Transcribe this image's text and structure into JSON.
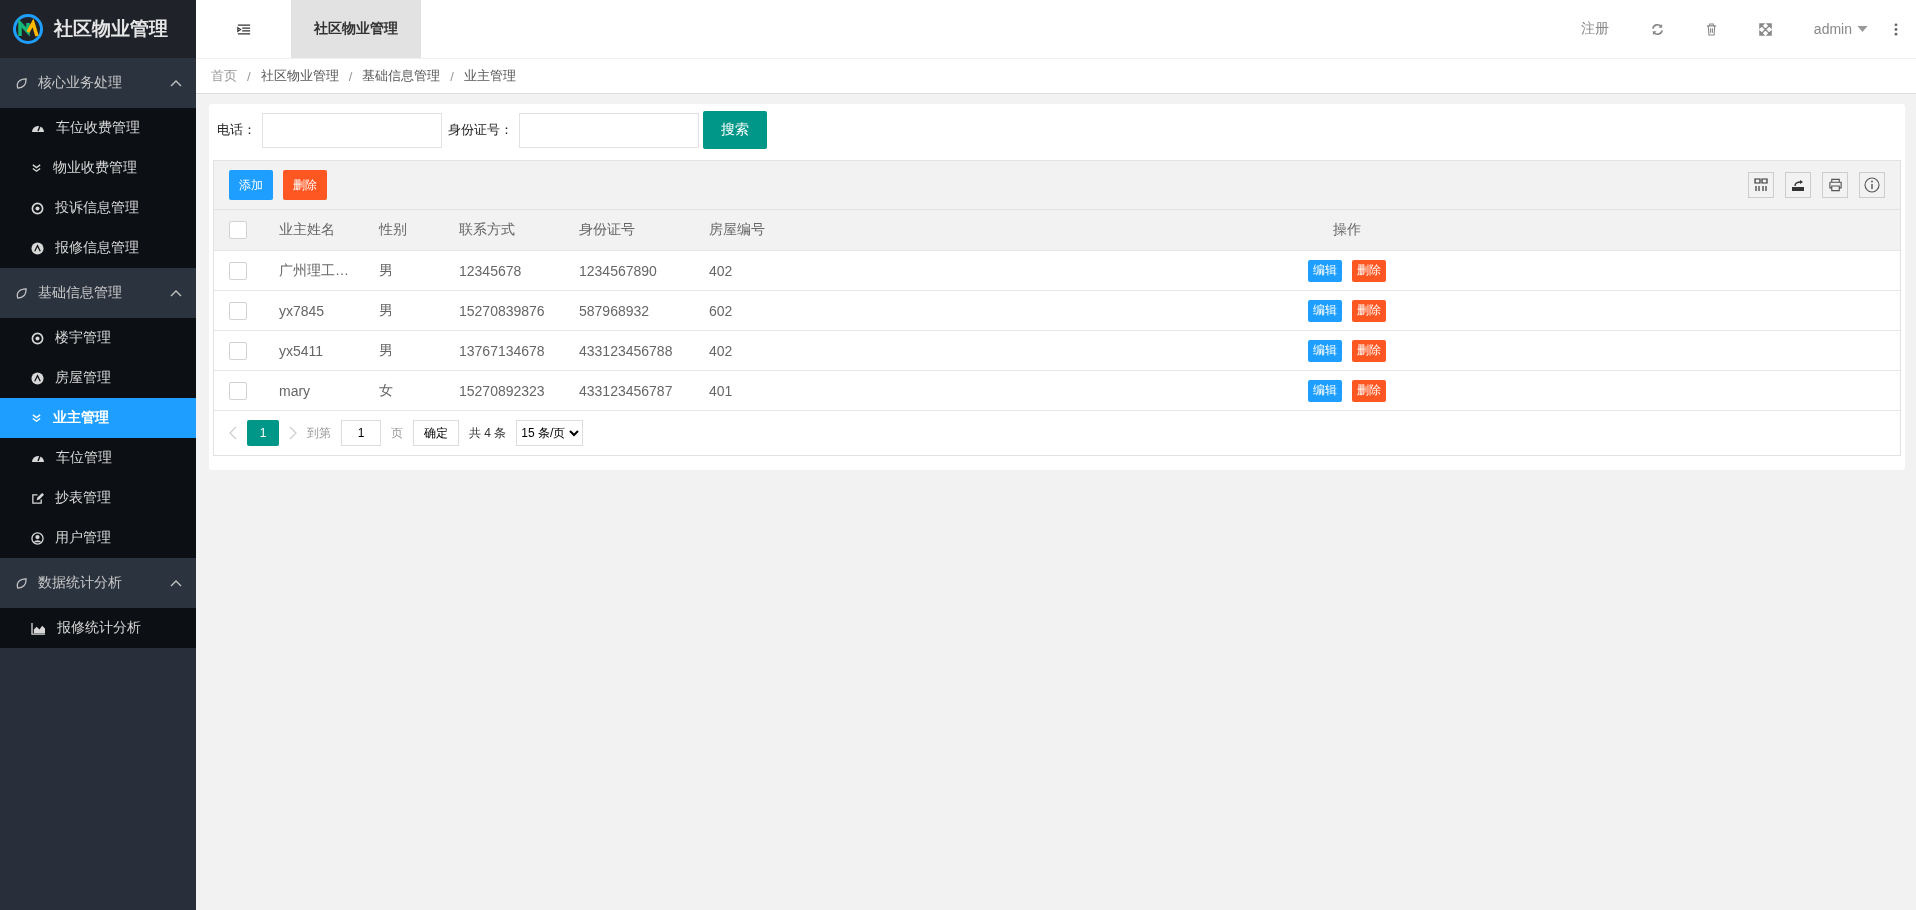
{
  "brand": {
    "title": "社区物业管理"
  },
  "sidebar": {
    "groups": [
      {
        "label": "核心业务处理",
        "expanded": true,
        "items": [
          {
            "label": "车位收费管理",
            "selected": false
          },
          {
            "label": "物业收费管理",
            "selected": false
          },
          {
            "label": "投诉信息管理",
            "selected": false
          },
          {
            "label": "报修信息管理",
            "selected": false
          }
        ]
      },
      {
        "label": "基础信息管理",
        "expanded": true,
        "items": [
          {
            "label": "楼宇管理",
            "selected": false
          },
          {
            "label": "房屋管理",
            "selected": false
          },
          {
            "label": "业主管理",
            "selected": true
          },
          {
            "label": "车位管理",
            "selected": false
          },
          {
            "label": "抄表管理",
            "selected": false
          },
          {
            "label": "用户管理",
            "selected": false
          }
        ]
      },
      {
        "label": "数据统计分析",
        "expanded": true,
        "items": [
          {
            "label": "报修统计分析",
            "selected": false
          }
        ]
      }
    ]
  },
  "header": {
    "tabs": [
      {
        "label": "社区物业管理",
        "selected": true
      }
    ],
    "register": "注册",
    "user": "admin"
  },
  "breadcrumb": {
    "separator": "/",
    "items": [
      "首页",
      "社区物业管理",
      "基础信息管理",
      "业主管理"
    ]
  },
  "search": {
    "fields": [
      {
        "label": "电话："
      },
      {
        "label": "身份证号："
      }
    ],
    "button": "搜索"
  },
  "toolbar": {
    "add": "添加",
    "delete": "删除"
  },
  "table": {
    "columns": [
      "业主姓名",
      "性别",
      "联系方式",
      "身份证号",
      "房屋编号",
      "操作"
    ],
    "header_checked": false,
    "rows": [
      {
        "checked": false,
        "cells": [
          "广州理工…",
          "男",
          "12345678",
          "1234567890",
          "402"
        ],
        "edit": "编辑",
        "delete": "删除"
      },
      {
        "checked": false,
        "cells": [
          "yx7845",
          "男",
          "15270839876",
          "587968932",
          "602"
        ],
        "edit": "编辑",
        "delete": "删除"
      },
      {
        "checked": false,
        "cells": [
          "yx5411",
          "男",
          "13767134678",
          "433123456788",
          "402"
        ],
        "edit": "编辑",
        "delete": "删除"
      },
      {
        "checked": false,
        "cells": [
          "mary",
          "女",
          "15270892323",
          "433123456787",
          "401"
        ],
        "edit": "编辑",
        "delete": "删除"
      }
    ]
  },
  "pagination": {
    "pages": [
      {
        "label": "1",
        "selected": true
      }
    ],
    "goto": "到第",
    "page_input": "1",
    "page_unit": "页",
    "confirm": "确定",
    "total": "共 4 条",
    "page_size": "15 条/页"
  }
}
